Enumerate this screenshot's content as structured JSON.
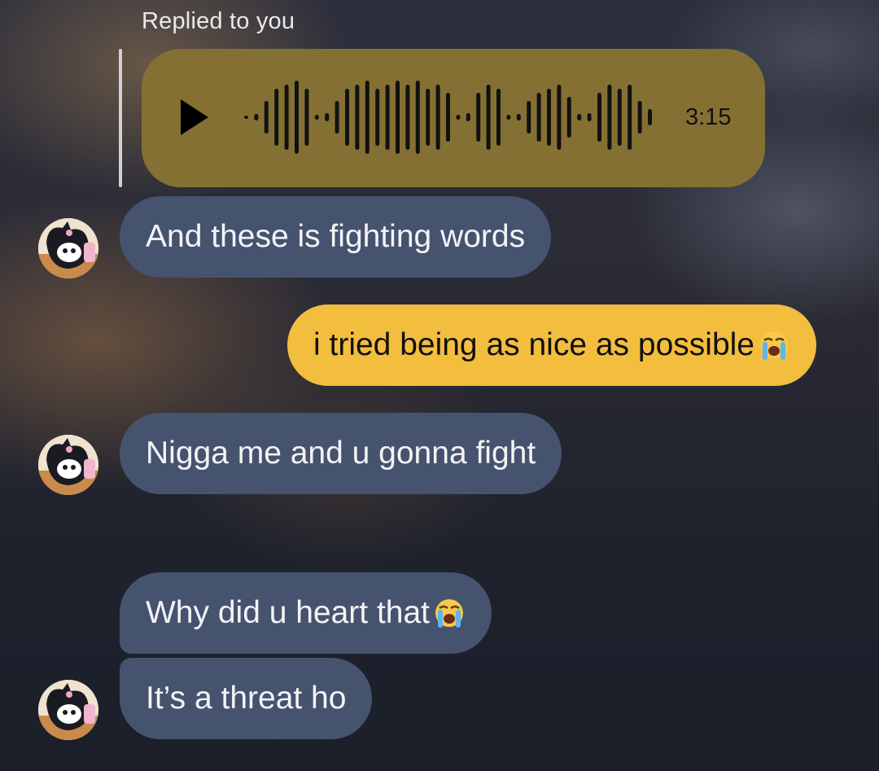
{
  "reply": {
    "label": "Replied to you",
    "voice_duration": "3:15"
  },
  "icons": {
    "play": "play-icon",
    "waveform": "audio-waveform-icon",
    "avatar": "kuromi-avatar",
    "emoji": "loudly-crying-face-emoji"
  },
  "colors": {
    "voice_bubble": "#857033",
    "incoming_bubble": "#45536f",
    "outgoing_bubble": "#f3bd3e"
  },
  "messages": [
    {
      "direction": "incoming",
      "text": "And these is fighting words"
    },
    {
      "direction": "outgoing",
      "text": "i tried being as nice as possible "
    },
    {
      "direction": "incoming",
      "text": "Nigga me and u gonna fight"
    },
    {
      "direction": "incoming",
      "text": "Why did u heart that"
    },
    {
      "direction": "incoming",
      "text": "It’s a threat ho"
    }
  ]
}
